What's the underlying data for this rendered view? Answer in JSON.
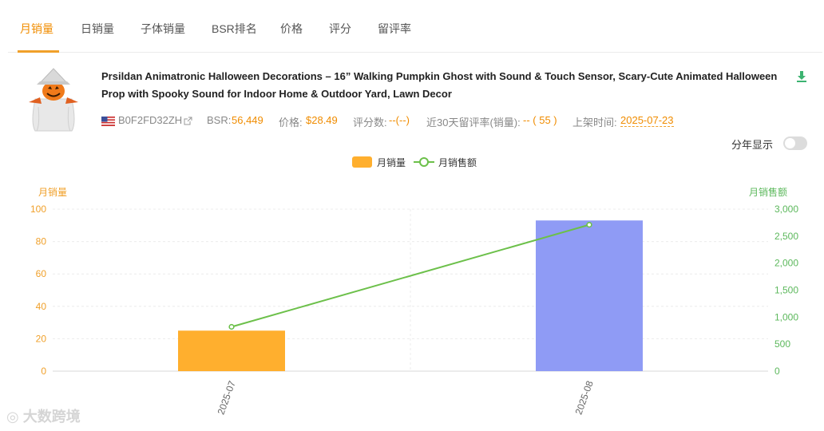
{
  "tabs": [
    {
      "label": "月销量",
      "active": true
    },
    {
      "label": "日销量",
      "active": false
    },
    {
      "label": "子体销量",
      "active": false
    },
    {
      "label": "BSR排名",
      "active": false
    },
    {
      "label": "价格",
      "active": false
    },
    {
      "label": "评分",
      "active": false
    },
    {
      "label": "留评率",
      "active": false
    }
  ],
  "product": {
    "title": "Prsildan Animatronic Halloween Decorations – 16” Walking Pumpkin Ghost with Sound & Touch Sensor, Scary-Cute Animated Halloween Prop with Spooky Sound for Indoor Home & Outdoor Yard, Lawn Decor",
    "asin": "B0F2FD32ZH",
    "bsr_label": "BSR:",
    "bsr_value": "56,449",
    "price_label": "价格:",
    "price_value": "$28.49",
    "rating_count_label": "评分数:",
    "rating_count_value": "--(--)",
    "review_rate_label": "近30天留评率(销量):",
    "review_rate_value": "-- ( 55 )",
    "listing_label": "上架时间:",
    "listing_value": "2025-07-23"
  },
  "controls": {
    "year_toggle_label": "分年显示",
    "year_toggle_on": false
  },
  "colors": {
    "accent": "#f08c00",
    "bar_primary": "#ffaf2e",
    "bar_secondary": "#8f9bf5",
    "line": "#6cc04a",
    "left_axis": "#f0a02a",
    "right_axis": "#5cb85c"
  },
  "icons": {
    "download": "download-icon",
    "external_link": "external-link-icon",
    "flag": "us-flag-icon"
  },
  "watermark": "大数跨境",
  "chart_data": {
    "type": "bar",
    "categories": [
      "2025-07",
      "2025-08"
    ],
    "series": [
      {
        "name": "月销量",
        "type": "bar",
        "axis": "left",
        "values": [
          25,
          93
        ]
      },
      {
        "name": "月销售额",
        "type": "line",
        "axis": "right",
        "values": [
          820,
          2710
        ]
      }
    ],
    "left_axis": {
      "title": "月销量",
      "min": 0,
      "max": 100,
      "ticks": [
        0,
        20,
        40,
        60,
        80,
        100
      ]
    },
    "right_axis": {
      "title": "月销售额",
      "min": 0,
      "max": 3000,
      "ticks": [
        "0",
        "500",
        "1,000",
        "1,500",
        "2,000",
        "2,500",
        "3,000"
      ]
    },
    "grid": true,
    "legend": "top-center"
  }
}
